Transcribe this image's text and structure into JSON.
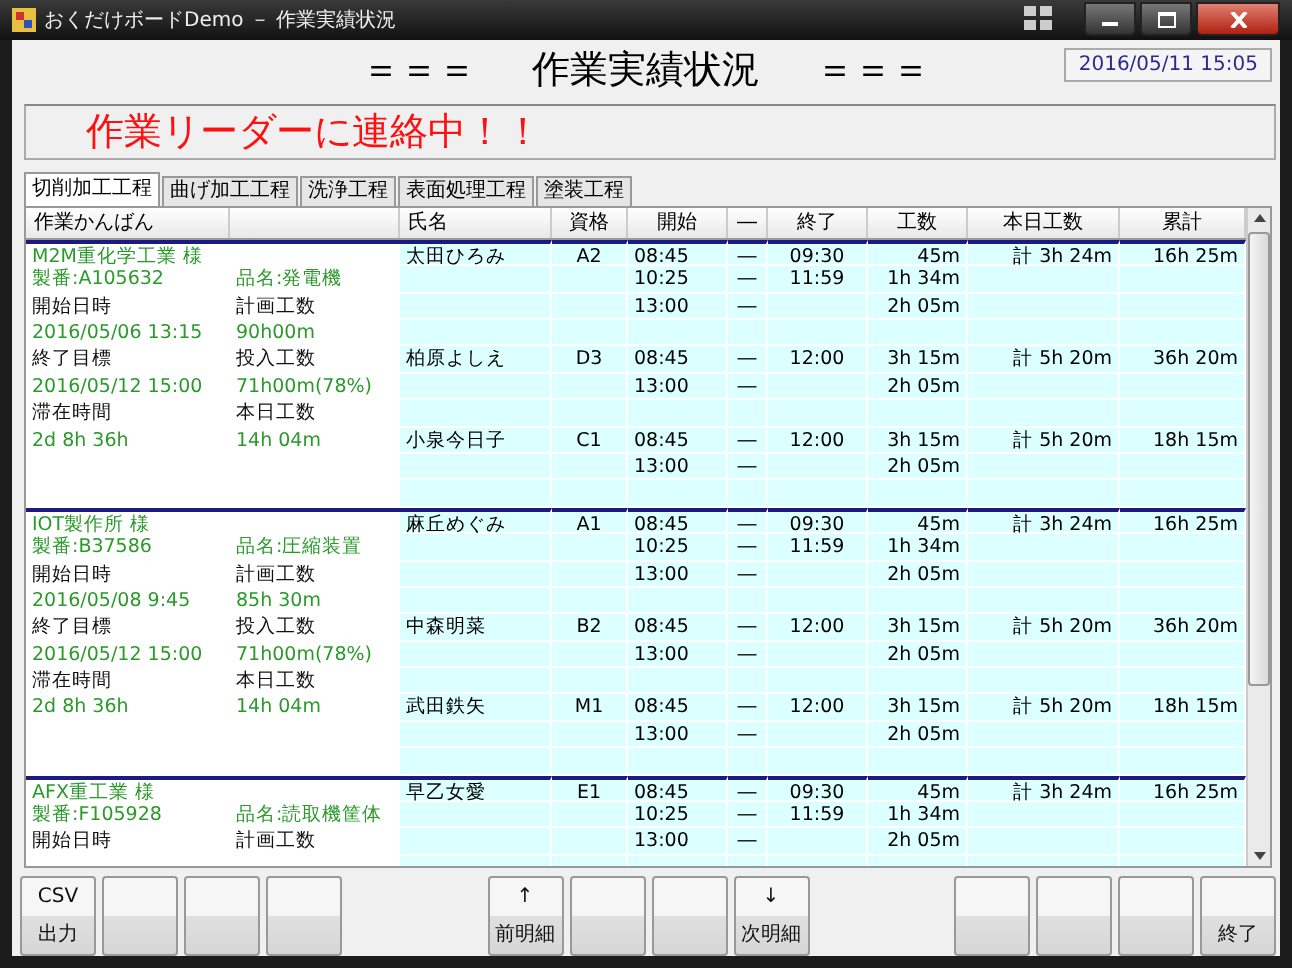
{
  "window": {
    "title": "おくだけボードDemo － 作業実績状況"
  },
  "heading": {
    "left": "＝＝＝",
    "title": "作業実績状況",
    "right": "＝＝＝",
    "datetime": "2016/05/11 15:05"
  },
  "alert": "作業リーダーに連絡中！！",
  "tabs": [
    {
      "label": "切削加工工程",
      "selected": true
    },
    {
      "label": "曲げ加工工程",
      "selected": false
    },
    {
      "label": "洗浄工程",
      "selected": false
    },
    {
      "label": "表面処理工程",
      "selected": false
    },
    {
      "label": "塗装工程",
      "selected": false
    }
  ],
  "table": {
    "columns": [
      "作業かんばん",
      "氏名",
      "資格",
      "開始",
      "―",
      "終了",
      "工数",
      "本日工数",
      "累計"
    ],
    "groups": [
      {
        "customer": "M2M重化学工業 様",
        "part_no": "製番:A105632",
        "product": "品名:発電機",
        "fields": [
          {
            "label": "開始日時",
            "value": "2016/05/06 13:15"
          },
          {
            "label": "計画工数",
            "value": "90h00m"
          },
          {
            "label": "終了目標",
            "value": "2016/05/12 15:00"
          },
          {
            "label": "投入工数",
            "value": "71h00m(78%)"
          },
          {
            "label": "滞在時間",
            "value": "2d 8h 36h"
          },
          {
            "label": "本日工数",
            "value": "14h 04m"
          }
        ],
        "workers": [
          {
            "name": "太田ひろみ",
            "grade": "A2",
            "today_total": "計 3h 24m",
            "cumulative": "16h 25m",
            "sessions": [
              {
                "start": "08:45",
                "dash": "―",
                "end": "09:30",
                "hours": "45m"
              },
              {
                "start": "10:25",
                "dash": "―",
                "end": "11:59",
                "hours": "1h 34m"
              },
              {
                "start": "13:00",
                "dash": "―",
                "hours": "2h 05m"
              }
            ]
          },
          {
            "name": "柏原よしえ",
            "grade": "D3",
            "today_total": "計 5h 20m",
            "cumulative": "36h 20m",
            "sessions": [
              {
                "start": "08:45",
                "dash": "―",
                "end": "12:00",
                "hours": "3h 15m"
              },
              {
                "start": "13:00",
                "dash": "―",
                "hours": "2h 05m"
              }
            ]
          },
          {
            "name": "小泉今日子",
            "grade": "C1",
            "today_total": "計 5h 20m",
            "cumulative": "18h 15m",
            "sessions": [
              {
                "start": "08:45",
                "dash": "―",
                "end": "12:00",
                "hours": "3h 15m"
              },
              {
                "start": "13:00",
                "dash": "―",
                "hours": "2h 05m"
              }
            ]
          }
        ]
      },
      {
        "customer": "IOT製作所 様",
        "part_no": "製番:B37586",
        "product": "品名:圧縮装置",
        "fields": [
          {
            "label": "開始日時",
            "value": "2016/05/08  9:45"
          },
          {
            "label": "計画工数",
            "value": "85h 30m"
          },
          {
            "label": "終了目標",
            "value": "2016/05/12 15:00"
          },
          {
            "label": "投入工数",
            "value": "71h00m(78%)"
          },
          {
            "label": "滞在時間",
            "value": "2d 8h 36h"
          },
          {
            "label": "本日工数",
            "value": "14h 04m"
          }
        ],
        "workers": [
          {
            "name": "麻丘めぐみ",
            "grade": "A1",
            "today_total": "計 3h 24m",
            "cumulative": "16h 25m",
            "sessions": [
              {
                "start": "08:45",
                "dash": "―",
                "end": "09:30",
                "hours": "45m"
              },
              {
                "start": "10:25",
                "dash": "―",
                "end": "11:59",
                "hours": "1h 34m"
              },
              {
                "start": "13:00",
                "dash": "―",
                "hours": "2h 05m"
              }
            ]
          },
          {
            "name": "中森明菜",
            "grade": "B2",
            "today_total": "計 5h 20m",
            "cumulative": "36h 20m",
            "sessions": [
              {
                "start": "08:45",
                "dash": "―",
                "end": "12:00",
                "hours": "3h 15m"
              },
              {
                "start": "13:00",
                "dash": "―",
                "hours": "2h 05m"
              }
            ]
          },
          {
            "name": "武田鉄矢",
            "grade": "M1",
            "today_total": "計 5h 20m",
            "cumulative": "18h 15m",
            "sessions": [
              {
                "start": "08:45",
                "dash": "―",
                "end": "12:00",
                "hours": "3h 15m"
              },
              {
                "start": "13:00",
                "dash": "―",
                "hours": "2h 05m"
              }
            ]
          }
        ]
      },
      {
        "customer": "AFX重工業 様",
        "part_no": "製番:F105928",
        "product": "品名:読取機筐体",
        "fields": [
          {
            "label": "開始日時"
          },
          {
            "label": "計画工数"
          }
        ],
        "workers": [
          {
            "name": "早乙女愛",
            "grade": "E1",
            "today_total": "計 3h 24m",
            "cumulative": "16h 25m",
            "sessions": [
              {
                "start": "08:45",
                "dash": "―",
                "end": "09:30",
                "hours": "45m"
              },
              {
                "start": "10:25",
                "dash": "―",
                "end": "11:59",
                "hours": "1h 34m"
              },
              {
                "start": "13:00",
                "dash": "―",
                "hours": "2h 05m"
              }
            ]
          }
        ]
      }
    ]
  },
  "button_groups": [
    [
      {
        "kind": "label",
        "top": "CSV",
        "bottom": "出力"
      },
      {
        "kind": "blank"
      },
      {
        "kind": "blank"
      },
      {
        "kind": "blank"
      }
    ],
    [
      {
        "kind": "label",
        "top": "↑",
        "bottom": "前明細"
      },
      {
        "kind": "blank"
      },
      {
        "kind": "blank"
      },
      {
        "kind": "label",
        "top": "↓",
        "bottom": "次明細"
      }
    ],
    [
      {
        "kind": "blank"
      },
      {
        "kind": "blank"
      },
      {
        "kind": "blank"
      },
      {
        "kind": "label",
        "bottom": "終了"
      }
    ]
  ]
}
